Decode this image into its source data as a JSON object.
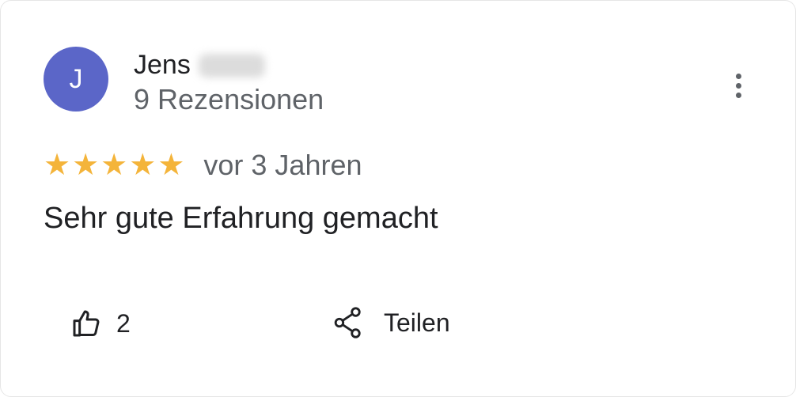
{
  "review": {
    "avatar_initial": "J",
    "avatar_color": "#5b66c8",
    "author_name": "Jens",
    "review_count": "9 Rezensionen",
    "rating": 5,
    "stars": [
      "★",
      "★",
      "★",
      "★",
      "★"
    ],
    "star_color": "#f4b43a",
    "time": "vor 3 Jahren",
    "text": "Sehr gute Erfahrung gemacht"
  },
  "actions": {
    "like_icon": "thumbs-up-icon",
    "like_count": "2",
    "share_icon": "share-icon",
    "share_label": "Teilen",
    "more_icon": "more-vert-icon"
  }
}
